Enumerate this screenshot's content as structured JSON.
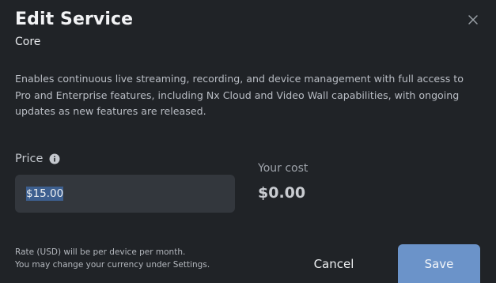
{
  "dialog": {
    "title": "Edit Service",
    "subtitle": "Core",
    "description": "Enables continuous live streaming, recording, and device management with full access to Pro and Enterprise features, including Nx Cloud and Video Wall capabilities, with ongoing updates as new features are released.",
    "close_icon": "close-icon"
  },
  "price": {
    "label": "Price",
    "info_icon": "info-icon",
    "value": "$15.00"
  },
  "cost": {
    "label": "Your cost",
    "value": "$0.00"
  },
  "footnote": {
    "line1": "Rate (USD) will be per device per month.",
    "line2": "You may change your currency under Settings."
  },
  "actions": {
    "cancel_label": "Cancel",
    "save_label": "Save"
  },
  "colors": {
    "background": "#202327",
    "input_bg": "#33373d",
    "selection": "#3d5f8f",
    "save_button": "#6b93c9"
  }
}
